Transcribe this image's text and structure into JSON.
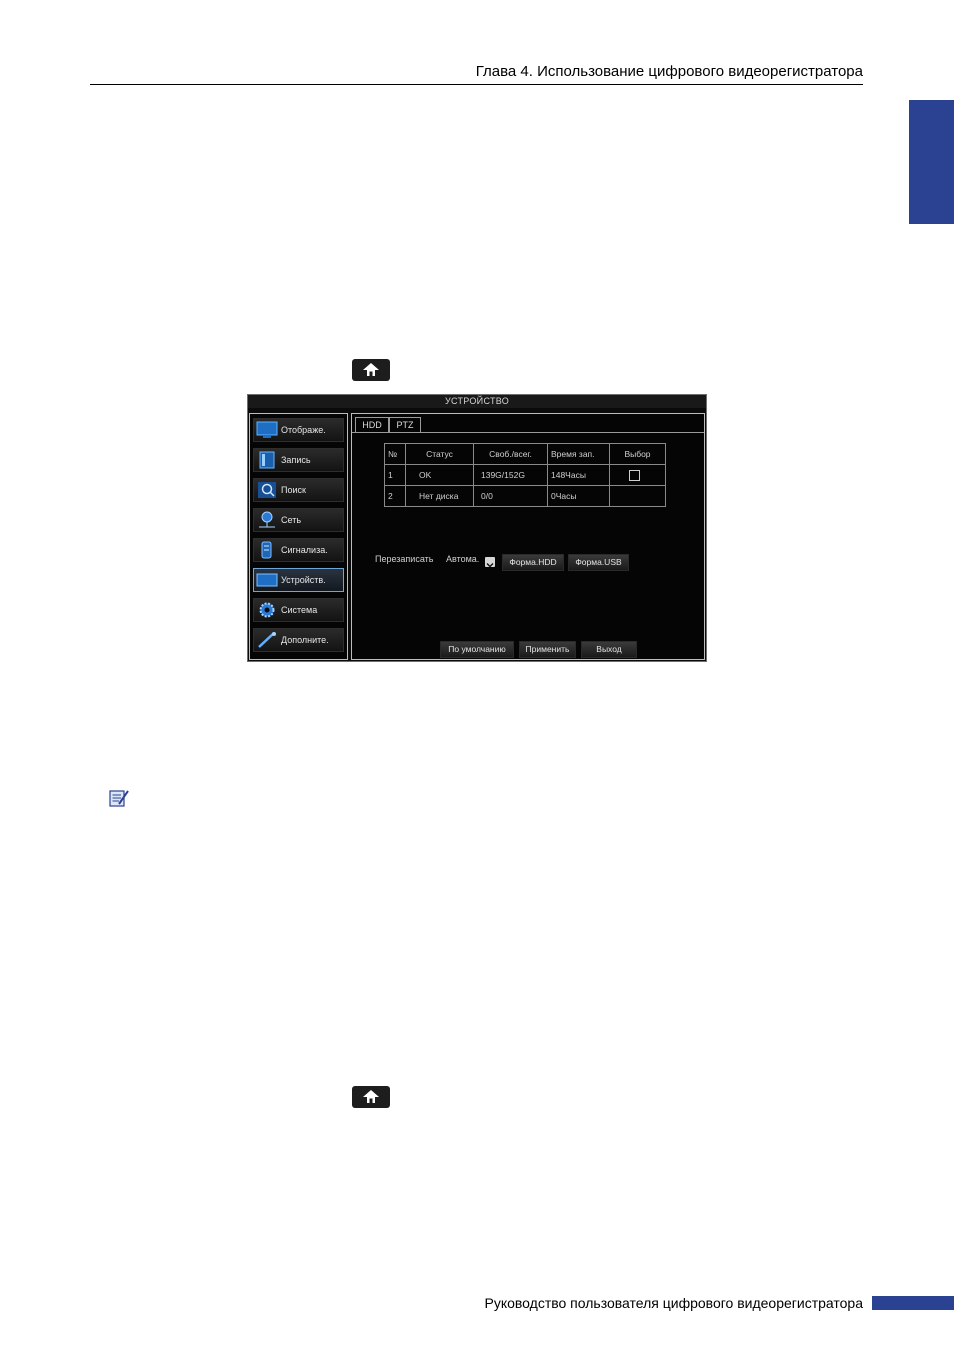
{
  "page": {
    "header_title": "Глава 4. Использование цифрового видеорегистратора",
    "footer_text": "Руководство пользователя цифрового видеорегистратора",
    "accent_color": "#2b4192"
  },
  "icons": {
    "home_button_top": "home-icon",
    "home_button_bottom": "home-icon",
    "note": "note-icon"
  },
  "dvr": {
    "title": "УСТРОЙСТВО",
    "menu": [
      {
        "label": "Отображе.",
        "icon": "monitor-icon"
      },
      {
        "label": "Запись",
        "icon": "film-icon"
      },
      {
        "label": "Поиск",
        "icon": "search-icon"
      },
      {
        "label": "Сеть",
        "icon": "network-icon"
      },
      {
        "label": "Сигнализа.",
        "icon": "alarm-icon"
      },
      {
        "label": "Устройств.",
        "icon": "device-icon",
        "active": true
      },
      {
        "label": "Система",
        "icon": "gear-icon"
      },
      {
        "label": "Дополните.",
        "icon": "tools-icon"
      }
    ],
    "tabs": [
      "HDD",
      "PTZ"
    ],
    "active_tab": "HDD",
    "table": {
      "headers": [
        "№",
        "Статус",
        "Своб./всег.",
        "Время зап.",
        "Выбор"
      ],
      "rows": [
        [
          "1",
          "OK",
          "139G/152G",
          "148Часы",
          ""
        ],
        [
          "2",
          "Нет диска",
          "0/0",
          "0Часы",
          ""
        ]
      ]
    },
    "overwrite_label": "Перезаписать",
    "overwrite_value": "Автома.",
    "format_hdd_label": "Форма.HDD",
    "format_usb_label": "Форма.USB",
    "default_label": "По умолчанию",
    "apply_label": "Применить",
    "exit_label": "Выход"
  }
}
